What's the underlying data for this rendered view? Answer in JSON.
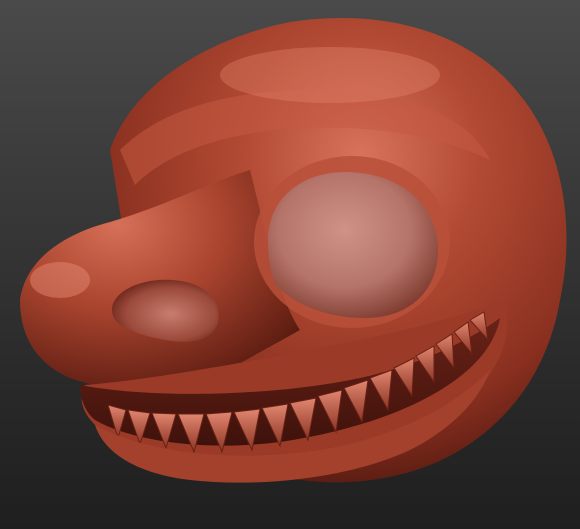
{
  "scene": {
    "subject": "sculpted-creature-head",
    "colors": {
      "background_top": "#4a4a4a",
      "background_bottom": "#1f1f1f",
      "clay_highlight": "#d06a55",
      "clay_mid": "#a8442f",
      "clay_shadow": "#5a1c12",
      "eye_socket": "#c8877b"
    }
  }
}
